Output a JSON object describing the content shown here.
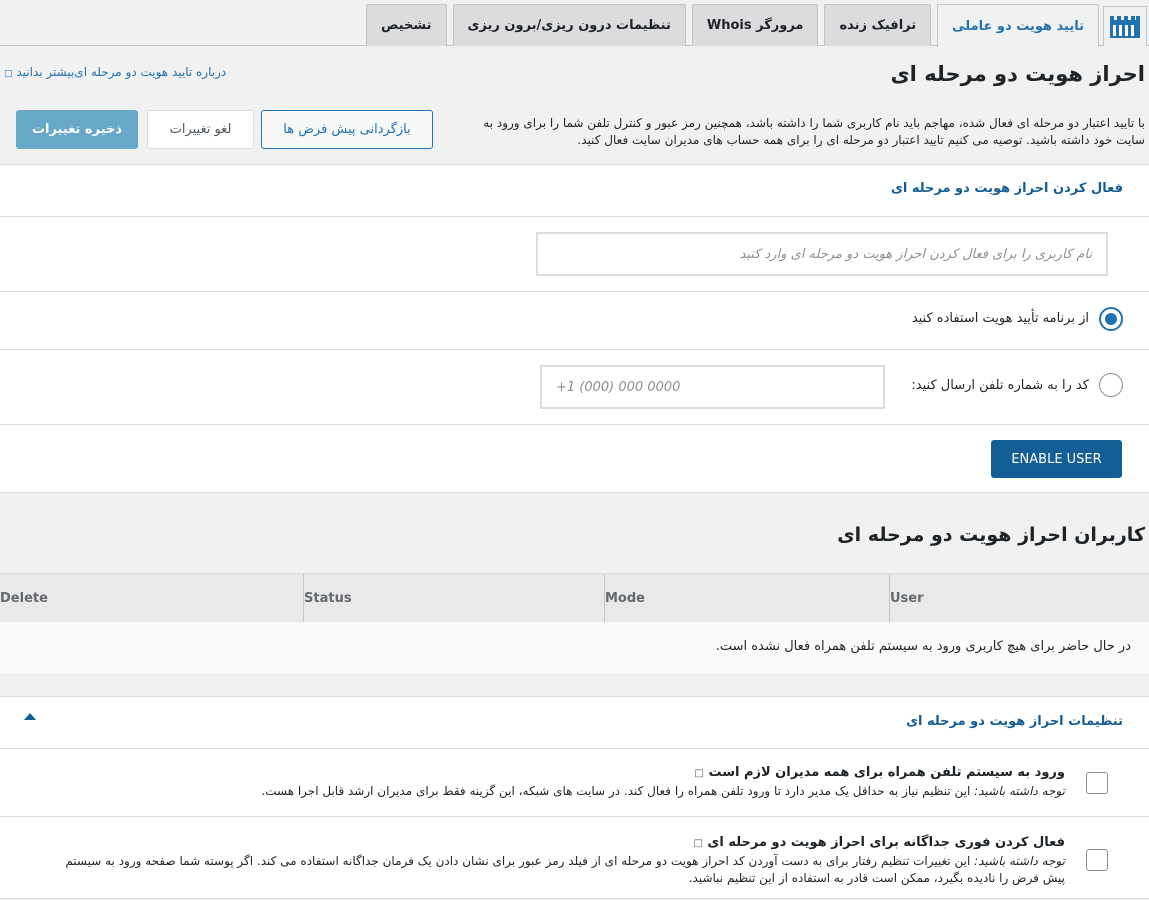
{
  "tabs": {
    "items": [
      {
        "label": "تایید هویت دو عاملی",
        "active": true
      },
      {
        "label": "ترافیک زنده",
        "active": false
      },
      {
        "label": "مرورگر Whois",
        "active": false
      },
      {
        "label": "تنظیمات درون ریزی/برون ریزی",
        "active": false
      },
      {
        "label": "تشخیص",
        "active": false
      }
    ]
  },
  "header": {
    "title": "احراز هویت دو مرحله ای",
    "learn_more": "درباره تایید هویت دو مرحله ای‌بیشتر بدانید",
    "intro": "با تایید اعتبار دو مرحله ای فعال شده، مهاجم باید نام کاربری شما را داشته باشد، همچنین رمز عبور و کنترل تلفن شما را برای ورود به سایت خود داشته باشید. توصیه می کنیم تایید اعتبار دو مرحله ای را برای همه حساب های مدیران سایت فعال کنید.",
    "reset_label": "بازگردانی پیش فرض ها",
    "cancel_label": "لغو تغییرات",
    "save_label": "ذخیره تغییرات"
  },
  "enable": {
    "title": "فعال کردن احراز هویت دو مرحله ای",
    "username_placeholder": "نام کاربری را برای فعال کردن احراز هویت دو مرحله ای وارد کنید",
    "option_app": "از برنامه تأیید هویت استفاده کنید",
    "option_sms": "کد را به شماره تلفن ارسال کنید:",
    "phone_placeholder": "+1 (000) 000 0000",
    "enable_button": "ENABLE USER"
  },
  "users": {
    "title": "کاربران احراز هویت دو مرحله ای",
    "columns": [
      "User",
      "Mode",
      "Status",
      "Delete"
    ],
    "empty": "در حال حاضر برای هیچ کاربری ورود به سیستم تلفن همراه فعال نشده است."
  },
  "settings": {
    "title": "تنظیمات احراز هویت دو مرحله ای",
    "items": [
      {
        "title": "ورود به سیستم تلفن همراه برای همه مدیران لازم است",
        "note_label": "توجه داشته باشید:",
        "note": "این تنظیم نیاز به حداقل یک مدیر دارد تا ورود تلفن همراه را فعال کند. در سایت های شبکه، این گزینه فقط برای مدیران ارشد قابل اجرا هست."
      },
      {
        "title": "فعال کردن فوری جداگانه برای احراز هویت دو مرحله ای",
        "note_label": "توجه داشته باشید:",
        "note": "این تغییرات تنظیم رفتار برای به دست آوردن کد احراز هویت دو مرحله ای از فیلد رمز عبور برای نشان دادن یک فرمان جداگانه استفاده می کند. اگر پوسته شما صفحه ورود به سیستم پیش فرض را نادیده بگیرد، ممکن است قادر به استفاده از این تنظیم نباشید."
      }
    ]
  },
  "colors": {
    "accent": "#2271b1",
    "button_primary": "#135e96",
    "save_button": "#67a7c7"
  }
}
